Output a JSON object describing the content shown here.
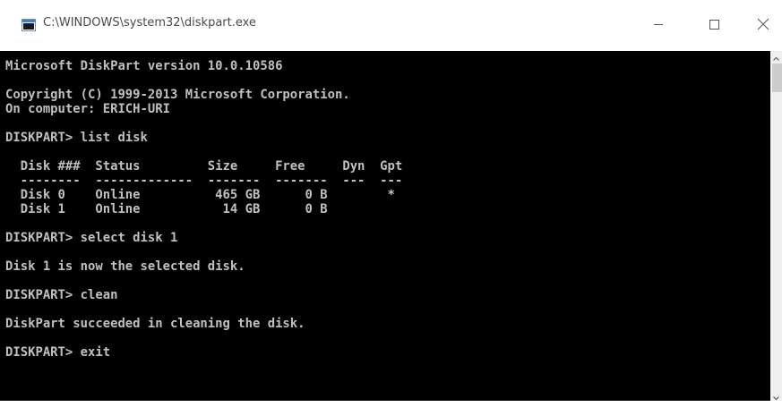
{
  "window": {
    "title": "C:\\WINDOWS\\system32\\diskpart.exe",
    "icon": "console-window-icon",
    "controls": [
      "minimize-icon",
      "maximize-icon",
      "close-icon"
    ]
  },
  "console": {
    "lines": [
      "Microsoft DiskPart version 10.0.10586",
      "Copyright (C) 1999-2013 Microsoft Corporation.",
      "On computer: ERICH-URI",
      "DISKPART> list disk",
      "  Disk ###  Status         Size     Free     Dyn  Gpt",
      "  --------  -------------  -------  -------  ---  ---",
      "  Disk 0    Online          465 GB      0 B        *",
      "  Disk 1    Online           14 GB      0 B",
      "DISKPART> select disk 1",
      "Disk 1 is now the selected disk.",
      "DISKPART> clean",
      "DiskPart succeeded in cleaning the disk.",
      "DISKPART> exit"
    ],
    "colors": {
      "background": "#000000",
      "text": "#c0c0c0"
    }
  }
}
